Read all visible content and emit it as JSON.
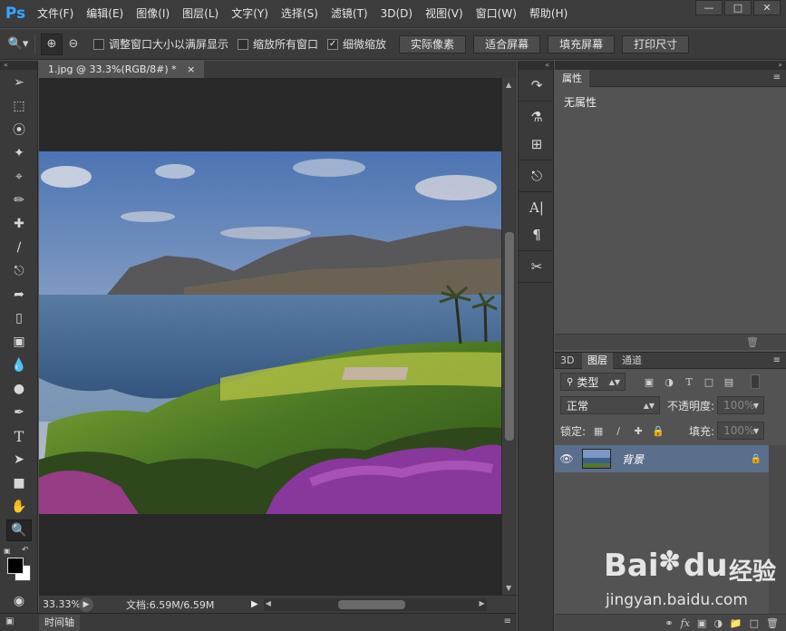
{
  "app": {
    "logo": "Ps",
    "menu": [
      "文件(F)",
      "编辑(E)",
      "图像(I)",
      "图层(L)",
      "文字(Y)",
      "选择(S)",
      "滤镜(T)",
      "3D(D)",
      "视图(V)",
      "窗口(W)",
      "帮助(H)"
    ],
    "window_controls": [
      "minimize-icon",
      "maximize-icon",
      "close-icon"
    ]
  },
  "options": {
    "checks": [
      {
        "label": "调整窗口大小以满屏显示",
        "checked": false
      },
      {
        "label": "缩放所有窗口",
        "checked": false
      },
      {
        "label": "细微缩放",
        "checked": true
      }
    ],
    "buttons": [
      "实际像素",
      "适合屏幕",
      "填充屏幕",
      "打印尺寸"
    ]
  },
  "document": {
    "tab_title": "1.jpg @ 33.3%(RGB/8#) *",
    "zoom": "33.33%",
    "doc_info": "文档:6.59M/6.59M"
  },
  "timeline": {
    "label": "时间轴"
  },
  "properties": {
    "tab": "属性",
    "empty_text": "无属性"
  },
  "layers": {
    "tabs": [
      "3D",
      "图层",
      "通道"
    ],
    "active_tab": "图层",
    "filter_kind": "类型",
    "blend_mode": "正常",
    "opacity_label": "不透明度:",
    "opacity_value": "100%",
    "lock_label": "锁定:",
    "fill_label": "填充:",
    "fill_value": "100%",
    "items": [
      {
        "name": "背景",
        "visible": true,
        "locked": true
      }
    ]
  },
  "watermark": {
    "brand": "Bai",
    "brand2": "du",
    "sub": "经验",
    "url": "jingyan.baidu.com"
  },
  "colors": {
    "accent": "#31a8ff",
    "selected_layer": "#5b6e8c",
    "panel": "#535353",
    "canvas": "#282828"
  }
}
